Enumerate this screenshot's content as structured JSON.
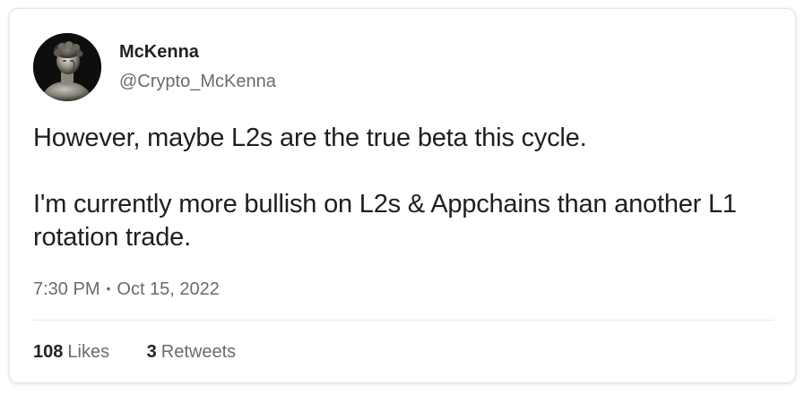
{
  "tweet": {
    "author": {
      "name": "McKenna",
      "handle": "@Crypto_McKenna",
      "avatar_icon": "statue-bust-avatar"
    },
    "text": "However, maybe L2s are the true beta this cycle.\n\nI'm currently more bullish on L2s & Appchains than another L1 rotation trade.",
    "time": "7:30 PM",
    "separator": "•",
    "date": "Oct 15, 2022",
    "stats": {
      "likes_count": "108",
      "likes_label": "Likes",
      "retweets_count": "3",
      "retweets_label": "Retweets"
    }
  },
  "colors": {
    "text_primary": "#1f1f1f",
    "text_secondary": "#6b6b6b",
    "border": "#e6e6e6",
    "avatar_background": "#111111"
  }
}
